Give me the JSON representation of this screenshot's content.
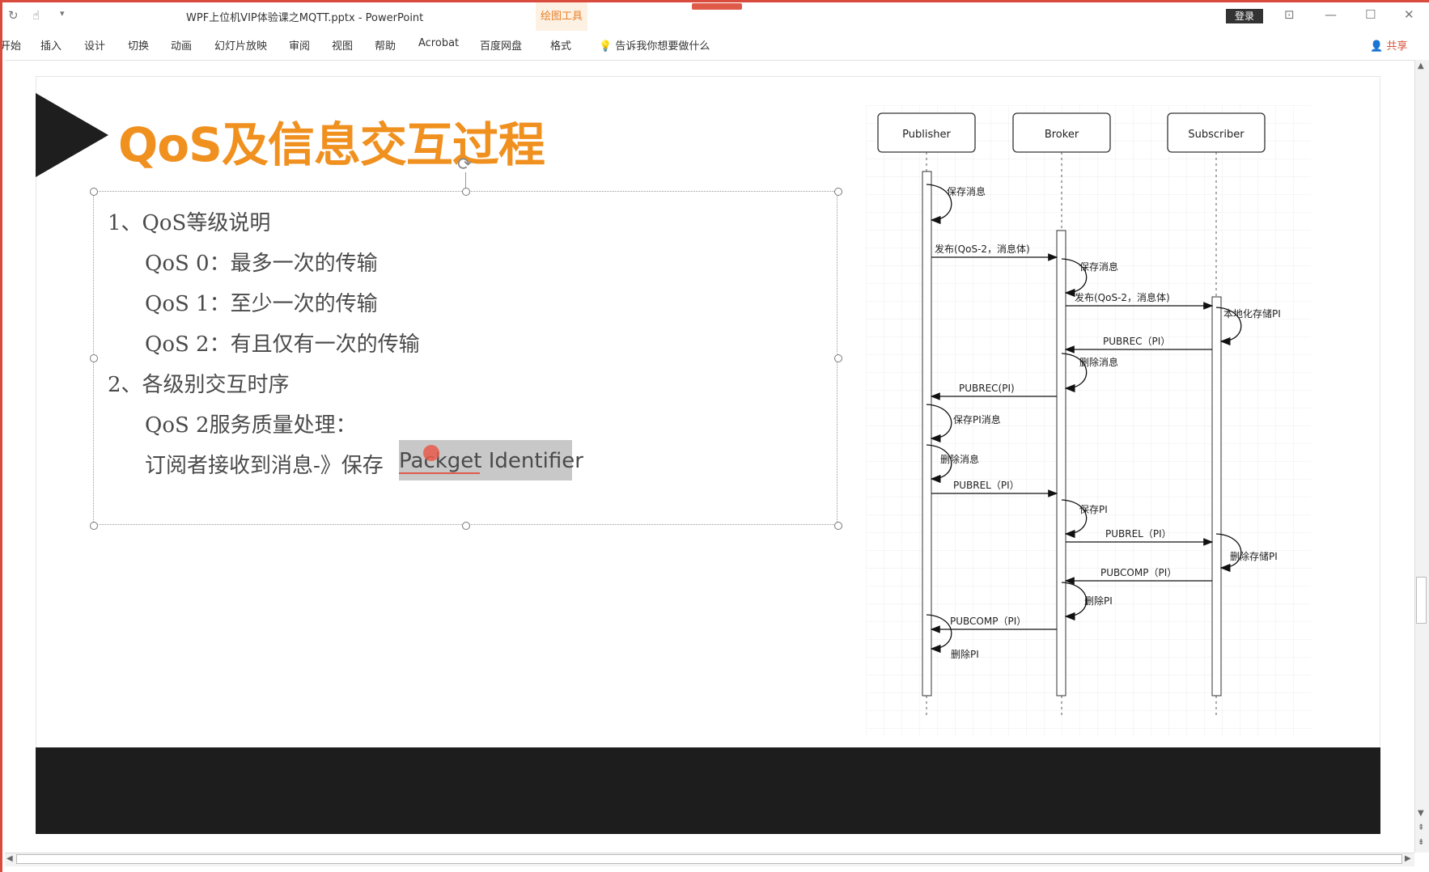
{
  "window": {
    "doc_title": "WPF上位机VIP体验课之MQTT.pptx  -  PowerPoint",
    "context_group": "绘图工具",
    "login": "登录",
    "controls": {
      "ribbon_options": "⊡",
      "minimize": "—",
      "maximize": "☐",
      "close": "✕"
    }
  },
  "ribbon": {
    "tabs": [
      "开始",
      "插入",
      "设计",
      "切换",
      "动画",
      "幻灯片放映",
      "审阅",
      "视图",
      "帮助",
      "Acrobat",
      "百度网盘",
      "格式"
    ],
    "tell_me": "告诉我你想要做什么",
    "share": "共享"
  },
  "slide": {
    "title": "QoS及信息交互过程",
    "bullets": [
      "1、QoS等级说明",
      "QoS 0：最多一次的传输",
      "QoS 1：至少一次的传输",
      "QoS 2：有且仅有一次的传输",
      "2、各级别交互时序",
      "QoS 2服务质量处理：",
      "订阅者接收到消息-》保存",
      "Packget Identifier"
    ]
  },
  "diagram": {
    "actors": [
      "Publisher",
      "Broker",
      "Subscriber"
    ],
    "self_labels": [
      "保存消息",
      "保存消息",
      "本地化存储PI",
      "删除消息",
      "保存PI消息",
      "删除消息",
      "保存PI",
      "删除存储PI",
      "删除PI",
      "删除PI"
    ],
    "messages": [
      "发布(QoS-2，消息体)",
      "发布(QoS-2，消息体)",
      "PUBREC（PI）",
      "PUBREC(PI)",
      "PUBREL（PI）",
      "PUBREL（PI）",
      "PUBCOMP（PI）",
      "PUBCOMP（PI）"
    ]
  },
  "colors": {
    "accent": "#f0901f",
    "footer": "#1d1d1d",
    "context": "#e8822a"
  }
}
